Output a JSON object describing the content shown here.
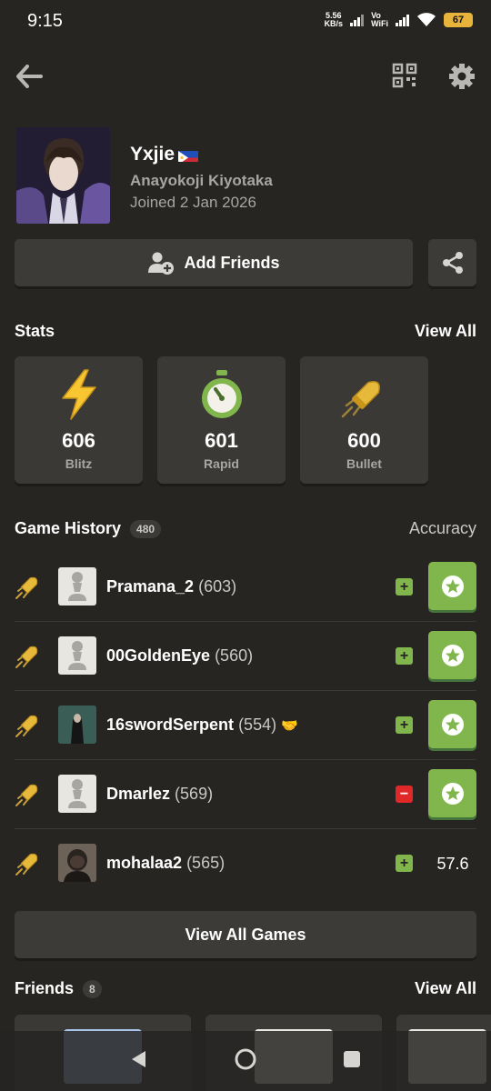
{
  "status_bar": {
    "time": "9:15",
    "speed_value": "5.56",
    "speed_unit": "KB/s",
    "volte_line1": "Vo",
    "volte_line2": "WiFi",
    "battery": "67"
  },
  "topbar": {
    "back_icon": "arrow-left-icon",
    "qr_icon": "qr-code-icon",
    "settings_icon": "gear-icon"
  },
  "profile": {
    "username": "Yxjie",
    "real_name": "Anayokoji Kiyotaka",
    "joined": "Joined 2 Jan 2026"
  },
  "actions": {
    "add_friends": "Add Friends"
  },
  "stats": {
    "title": "Stats",
    "view_all": "View All",
    "items": [
      {
        "value": "606",
        "label": "Blitz",
        "icon": "lightning-icon"
      },
      {
        "value": "601",
        "label": "Rapid",
        "icon": "stopwatch-icon"
      },
      {
        "value": "600",
        "label": "Bullet",
        "icon": "bullet-icon"
      }
    ]
  },
  "game_history": {
    "title": "Game History",
    "count": "480",
    "accuracy_label": "Accuracy",
    "games": [
      {
        "opponent": "Pramana_2",
        "rating": "(603)",
        "result": "+",
        "accuracy": ""
      },
      {
        "opponent": "00GoldenEye",
        "rating": "(560)",
        "result": "+",
        "accuracy": ""
      },
      {
        "opponent": "16swordSerpent",
        "rating": "(554)",
        "result": "+",
        "accuracy": ""
      },
      {
        "opponent": "Dmarlez",
        "rating": "(569)",
        "result": "−",
        "accuracy": ""
      },
      {
        "opponent": "mohalaa2",
        "rating": "(565)",
        "result": "+",
        "accuracy": "57.6"
      }
    ],
    "view_all_games": "View All Games"
  },
  "friends": {
    "title": "Friends",
    "count": "8",
    "view_all": "View All"
  },
  "colors": {
    "background": "#262522",
    "card": "#3a3936",
    "win_green": "#81b64c",
    "loss_red": "#e02828",
    "muted_text": "#a7a6a2"
  }
}
